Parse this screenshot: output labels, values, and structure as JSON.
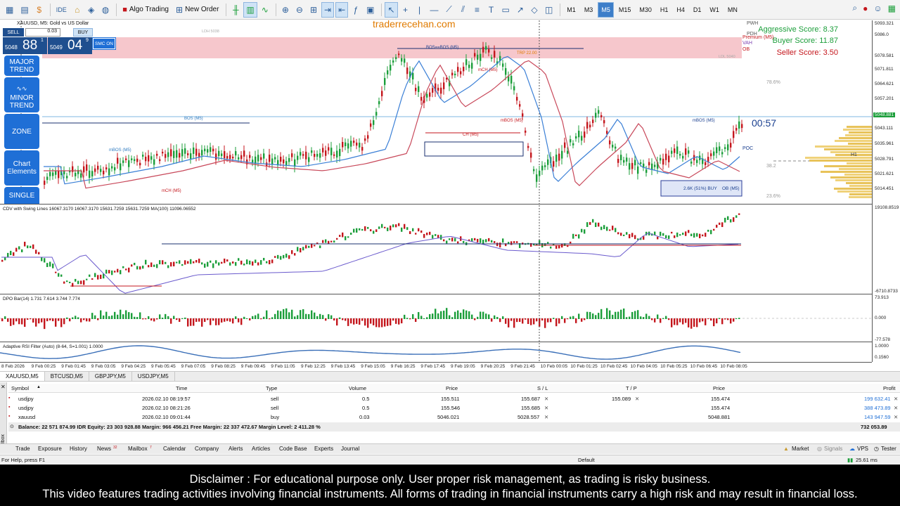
{
  "toolbar": {
    "algo_trading": "Algo Trading",
    "new_order": "New Order",
    "ide_label": "IDE",
    "timeframes": [
      "M1",
      "M5",
      "M15",
      "M30",
      "H1",
      "H4",
      "D1",
      "W1",
      "MN"
    ],
    "prefix_tf": "M3",
    "active_timeframe": "M5"
  },
  "chart": {
    "title": "XAUUSD, M5:  Gold vs US Dollar",
    "watermark": "traderrecehan.com",
    "countdown": "00:57",
    "aggressive_score": "Aggressive Score: 8.37",
    "buyer_score": "Buyer Score: 11.87",
    "seller_score": "Seller Score: 3.50",
    "labels": {
      "pwh": "PWH",
      "pdh": "PDH",
      "premium": "Premium (M5)",
      "vah": "VAH",
      "ob": "OB",
      "bos_bos": "BOS==BOS (M5)",
      "bos_m5": "BOS (M5)",
      "ch_m5": "CH (M5)",
      "mbos_m5": "mBOS (M5)",
      "mch_m5": "mCH (M5)",
      "pct_786": "78.6%",
      "pct_382": "38.2",
      "pct_236": "23.6%",
      "buy_box": "2.6K (51%) BUY",
      "ob_m5": "OB (M5)",
      "poc": "POC",
      "h1": "H1",
      "trp": "TRP 22.00",
      "ldh": "LDH 5038",
      "ldl": "LDL 5040"
    },
    "colors": {
      "bull": "#1b9e3a",
      "bear": "#c4161c",
      "premium_zone": "#f6c7cc",
      "accent": "#1f6fd6"
    }
  },
  "tradepanel": {
    "sell": "SELL",
    "buy": "BUY",
    "lot": "0.03",
    "sell_prefix": "5048",
    "sell_big": "88",
    "sell_sup": "1",
    "buy_prefix": "5049",
    "buy_big": "04",
    "buy_sup": "9",
    "smc": "SMC ON"
  },
  "sidebar": {
    "major_trend": "MAJOR TREND",
    "minor_trend": "MINOR TREND",
    "zone": "ZONE",
    "chart_elements": "Chart Elements",
    "single": "SINGLE"
  },
  "indicators": {
    "cdv": "CDV with Swing Lines 16067.3170 16067.3170 15631.7259 15631.7259 MA(100) 11096.06552",
    "dpo": "DPO Bar(14) 1.731 7.614 3.744 7.774",
    "rsi": "Adaptive RSI Filter (Auto) (8-64, S=1.001) 1.0000"
  },
  "axis": {
    "main": [
      "5093.321",
      "5086.0",
      "5078.581",
      "5071.811",
      "5064.621",
      "5057.201",
      "5050.391",
      "5043.111",
      "5035.961",
      "5028.791",
      "5021.621",
      "5014.451"
    ],
    "cdv": [
      "19108.8519",
      "-6710.8733"
    ],
    "dpo": [
      "73.913",
      "0.000",
      "-77.578"
    ],
    "rsi": [
      "1.0000",
      "0.1560"
    ]
  },
  "timeaxis": [
    "8 Feb 2026",
    "9 Feb 00:25",
    "9 Feb 01:45",
    "9 Feb 03:05",
    "9 Feb 04:25",
    "9 Feb 05:45",
    "9 Feb 07:05",
    "9 Feb 08:25",
    "9 Feb 09:45",
    "9 Feb 11:05",
    "9 Feb 12:25",
    "9 Feb 13:45",
    "9 Feb 15:05",
    "9 Feb 16:25",
    "9 Feb 17:45",
    "9 Feb 19:05",
    "9 Feb 20:25",
    "9 Feb 21:45",
    "10 Feb 00:05",
    "10 Feb 01:25",
    "10 Feb 02:45",
    "10 Feb 04:05",
    "10 Feb 05:25",
    "10 Feb 06:45",
    "10 Feb 08:05"
  ],
  "chart_tabs": [
    "XAUUSD,M5",
    "BTCUSD,M5",
    "GBPJPY,M5",
    "USDJPY,M5"
  ],
  "trade": {
    "headers": {
      "symbol": "Symbol",
      "time": "Time",
      "type": "Type",
      "volume": "Volume",
      "price": "Price",
      "sl": "S / L",
      "tp": "T / P",
      "cur_price": "Price",
      "profit": "Profit"
    },
    "rows": [
      {
        "symbol": "usdjpy",
        "time": "2026.02.10 08:19:57",
        "type": "sell",
        "volume": "0.5",
        "price": "155.511",
        "sl": "155.687",
        "tp": "155.089",
        "cur": "155.474",
        "profit": "199 632.41"
      },
      {
        "symbol": "usdjpy",
        "time": "2026.02.10 08:21:26",
        "type": "sell",
        "volume": "0.5",
        "price": "155.546",
        "sl": "155.685",
        "tp": "",
        "cur": "155.474",
        "profit": "388 473.89"
      },
      {
        "symbol": "xauusd",
        "time": "2026.02.10 09:01:44",
        "type": "buy",
        "volume": "0.03",
        "price": "5046.021",
        "sl": "5028.557",
        "tp": "",
        "cur": "5048.881",
        "profit": "143 947.59"
      }
    ],
    "balance": "Balance: 22 571 874.99 IDR  Equity: 23 303 928.88  Margin: 966 456.21  Free Margin: 22 337 472.67  Margin Level: 2 411.28 %",
    "total": "732 053.89"
  },
  "bottom_tabs": [
    "Trade",
    "Exposure",
    "History",
    "News",
    "Mailbox",
    "Calendar",
    "Company",
    "Alerts",
    "Articles",
    "Code Base",
    "Experts",
    "Journal"
  ],
  "news_badge": "32",
  "mailbox_badge": "7",
  "toolbox_label": "Toolbox",
  "bottom_right": [
    "Market",
    "Signals",
    "VPS",
    "Tester"
  ],
  "status": {
    "help": "For Help, press F1",
    "profile": "Default",
    "ping": "25.61 ms"
  },
  "disclaimer": {
    "line1": "Disclaimer : For educational purpose only. User proper risk management, as trading is risky business.",
    "line2": "This video features trading activities involving financial instruments. All forms of trading in financial instruments carry a high risk and may result in financial loss."
  }
}
